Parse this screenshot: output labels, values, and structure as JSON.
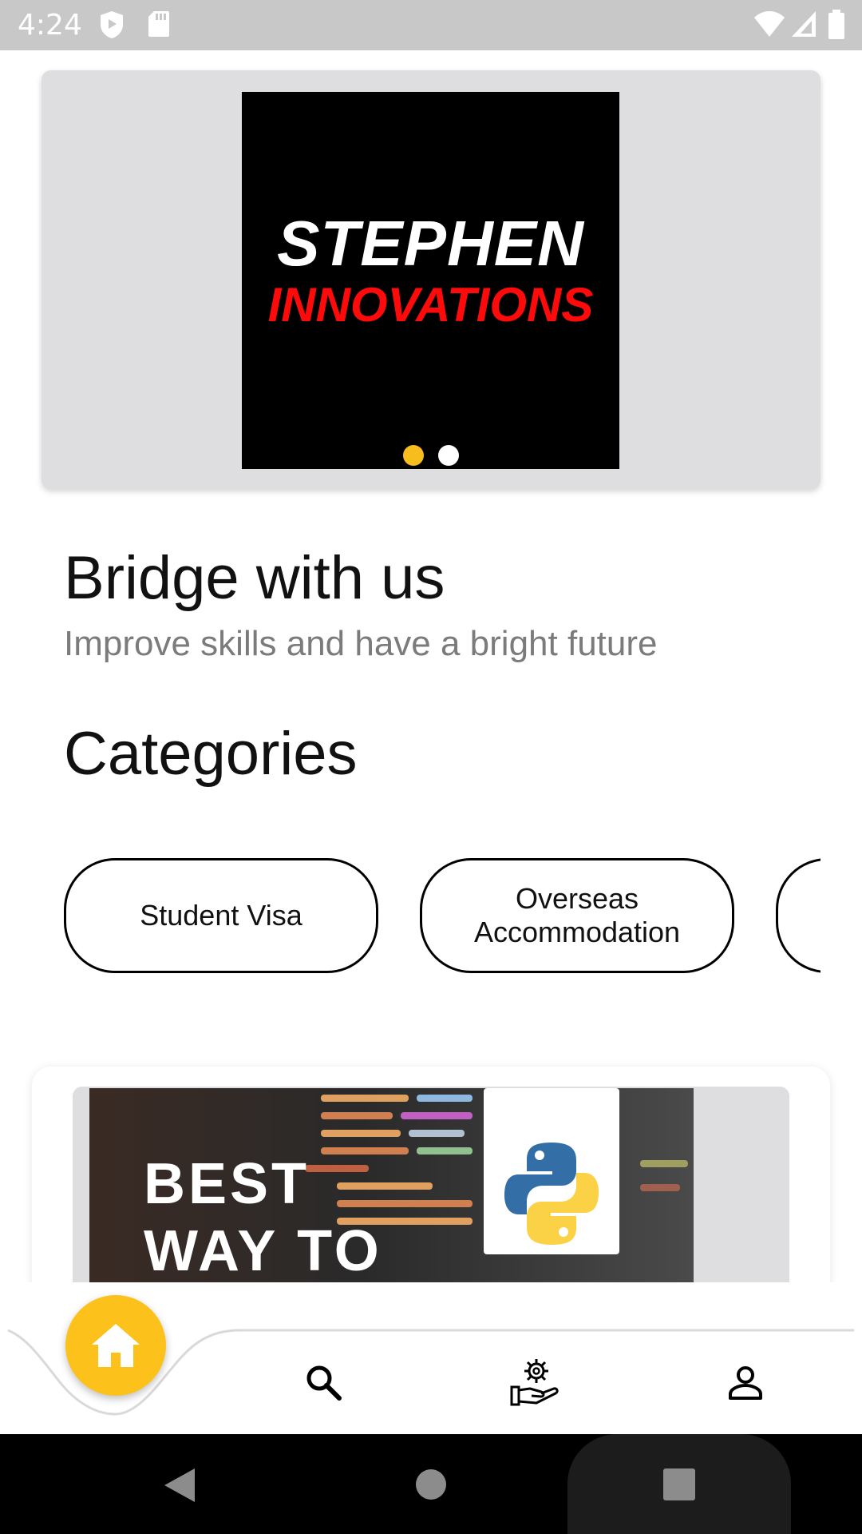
{
  "status_bar": {
    "time": "4:24",
    "icons": [
      "shield-icon",
      "sd-card-icon",
      "wifi-icon",
      "signal-icon",
      "battery-icon"
    ]
  },
  "banner": {
    "line1": "STEPHEN",
    "line2": "INNOVATIONS",
    "slide_count": 2,
    "active_slide": 1,
    "colors": {
      "active_dot": "#f6bd1d",
      "inactive_dot": "#ffffff",
      "line2": "#ff0a0a"
    }
  },
  "hero": {
    "title": "Bridge with us",
    "subtitle": "Improve skills and have a bright future"
  },
  "categories": {
    "title": "Categories",
    "items": [
      "Student Visa",
      "Overseas\nAccommodation",
      ""
    ]
  },
  "course_card": {
    "thumbnail_text": "BEST\nWAY TO",
    "logo": "python-logo-icon"
  },
  "bottom_nav": {
    "items": [
      {
        "icon": "home-icon",
        "active": true
      },
      {
        "icon": "search-icon",
        "active": false
      },
      {
        "icon": "services-icon",
        "active": false
      },
      {
        "icon": "profile-icon",
        "active": false
      }
    ],
    "accent": "#fcc21b"
  },
  "system_nav": [
    "back-icon",
    "home-circle-icon",
    "recents-icon"
  ]
}
